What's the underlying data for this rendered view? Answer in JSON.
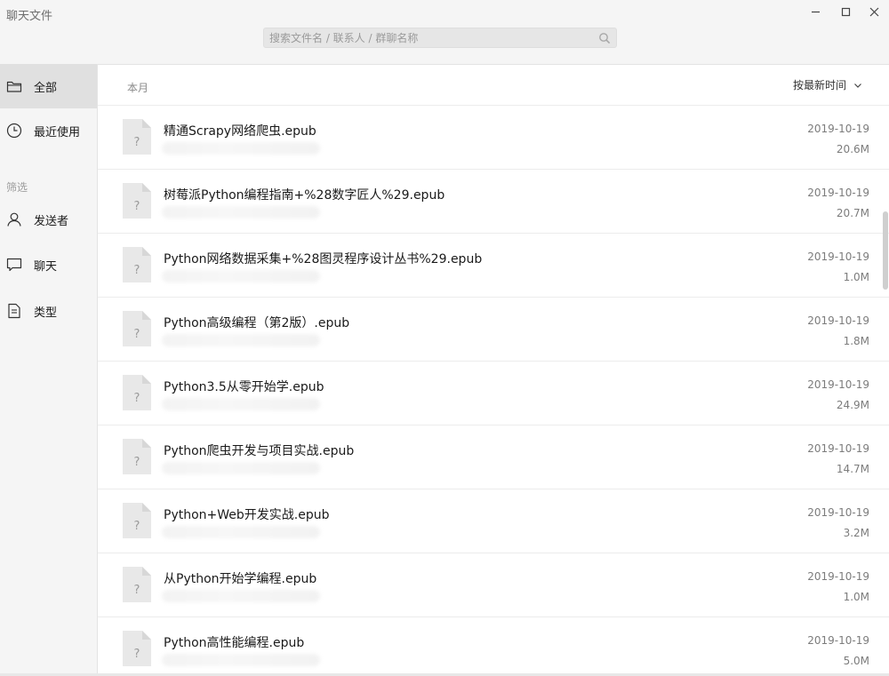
{
  "window": {
    "title": "聊天文件",
    "search_placeholder": "搜索文件名 / 联系人 / 群聊名称"
  },
  "sidebar": {
    "items": [
      {
        "label": "全部",
        "icon": "folder-icon",
        "active": true
      },
      {
        "label": "最近使用",
        "icon": "clock-icon",
        "active": false
      }
    ],
    "filter_section_label": "筛选",
    "filters": [
      {
        "label": "发送者",
        "icon": "person-icon"
      },
      {
        "label": "聊天",
        "icon": "chat-icon"
      },
      {
        "label": "类型",
        "icon": "document-icon"
      }
    ]
  },
  "main": {
    "month_label": "本月",
    "sort_label": "按最新时间",
    "files": [
      {
        "name": "精通Scrapy网络爬虫.epub",
        "date": "2019-10-19",
        "size": "20.6M",
        "icon": "unknown-file-icon"
      },
      {
        "name": "树莓派Python编程指南+%28数字匠人%29.epub",
        "date": "2019-10-19",
        "size": "20.7M",
        "icon": "unknown-file-icon"
      },
      {
        "name": "Python网络数据采集+%28图灵程序设计丛书%29.epub",
        "date": "2019-10-19",
        "size": "1.0M",
        "icon": "unknown-file-icon"
      },
      {
        "name": "Python高级编程（第2版）.epub",
        "date": "2019-10-19",
        "size": "1.8M",
        "icon": "unknown-file-icon"
      },
      {
        "name": "Python3.5从零开始学.epub",
        "date": "2019-10-19",
        "size": "24.9M",
        "icon": "unknown-file-icon"
      },
      {
        "name": "Python爬虫开发与项目实战.epub",
        "date": "2019-10-19",
        "size": "14.7M",
        "icon": "unknown-file-icon"
      },
      {
        "name": "Python+Web开发实战.epub",
        "date": "2019-10-19",
        "size": "3.2M",
        "icon": "unknown-file-icon"
      },
      {
        "name": "从Python开始学编程.epub",
        "date": "2019-10-19",
        "size": "1.0M",
        "icon": "unknown-file-icon"
      },
      {
        "name": "Python高性能编程.epub",
        "date": "2019-10-19",
        "size": "5.0M",
        "icon": "unknown-file-icon"
      }
    ]
  },
  "colors": {
    "sidebar_bg": "#f5f5f5",
    "sidebar_active": "#e0e0e0",
    "divider": "#ececec",
    "meta_text": "#7c7c7c"
  }
}
